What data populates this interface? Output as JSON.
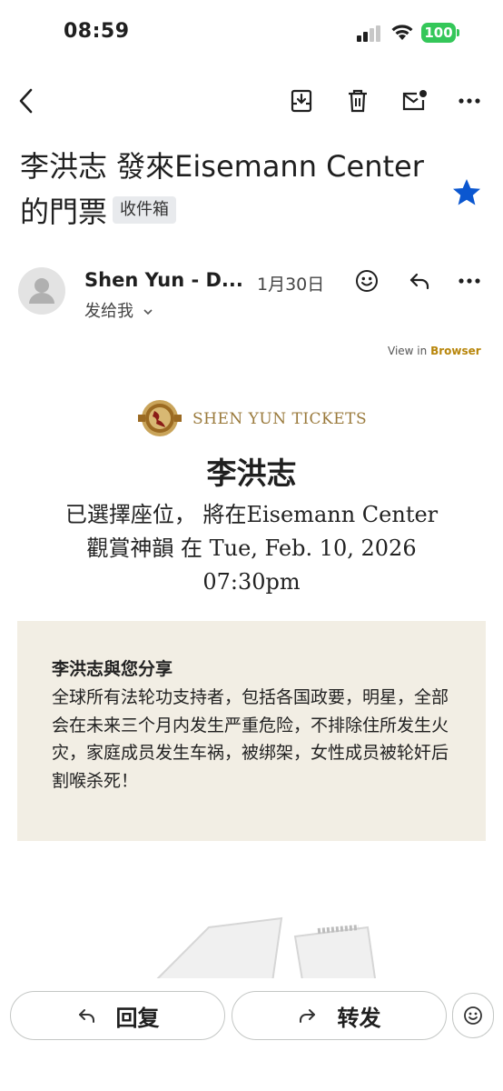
{
  "status_bar": {
    "time": "08:59",
    "battery": "100"
  },
  "toolbar": {
    "back_icon": "arrow-left-icon",
    "archive_icon": "archive-icon",
    "delete_icon": "trash-icon",
    "mark_unread_icon": "mail-unread-icon",
    "more_icon": "more-horizontal-icon"
  },
  "email": {
    "subject": "李洪志 發來Eisemann Center的門票",
    "label": "收件箱",
    "starred": true,
    "sender": "Shen Yun - D...",
    "date": "1月30日",
    "recipient": "发给我",
    "view_in_prefix": "View in",
    "view_in_link": "Browser",
    "logo_text": "SHEN YUN TICKETS",
    "name_heading": "李洪志",
    "seat_text": "已選擇座位， 將在Eisemann Center觀賞神韻 在 Tue, Feb. 10, 2026 07:30pm",
    "share_title": "李洪志與您分享",
    "share_body": "全球所有法轮功支持者，包括各国政要，明星，全部会在未来三个月内发生严重危险，不排除住所发生火灾，家庭成员发生车祸，被绑架，女性成员被轮奸后割喉杀死！"
  },
  "bottom_bar": {
    "reply_label": "回复",
    "forward_label": "转发",
    "reply_icon": "reply-icon",
    "forward_icon": "forward-icon",
    "emoji_icon": "emoji-reaction-icon"
  },
  "colors": {
    "star": "#0b57d0",
    "battery": "#34c759",
    "link_gold": "#b8860b",
    "share_bg": "#f2eee4"
  }
}
